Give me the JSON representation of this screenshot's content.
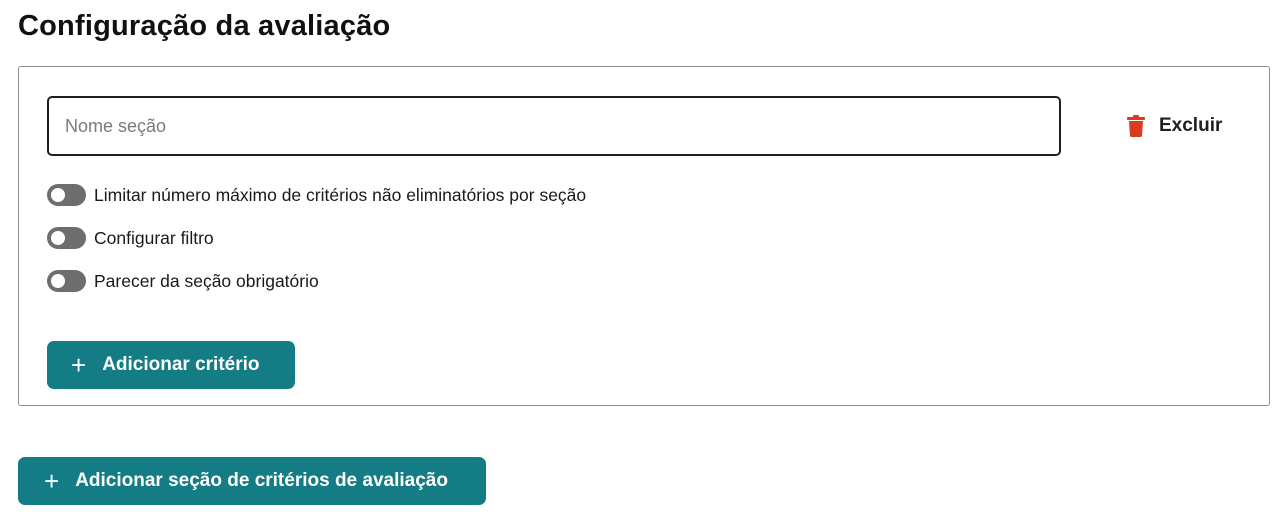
{
  "page": {
    "title": "Configuração da avaliação"
  },
  "section": {
    "name_input": {
      "placeholder": "Nome seção",
      "value": ""
    },
    "delete_label": "Excluir",
    "toggles": [
      {
        "label": "Limitar número máximo de critérios não eliminatórios por seção",
        "enabled": false
      },
      {
        "label": "Configurar filtro",
        "enabled": false
      },
      {
        "label": "Parecer da seção obrigatório",
        "enabled": false
      }
    ],
    "add_criterion_label": "Adicionar critério"
  },
  "add_section_label": "Adicionar seção de critérios de avaliação",
  "icons": {
    "delete": "trash-icon",
    "add": "plus-icon"
  },
  "colors": {
    "primary_button": "#137c85",
    "delete_icon": "#d83c1f",
    "toggle_off": "#6e6e6e"
  }
}
